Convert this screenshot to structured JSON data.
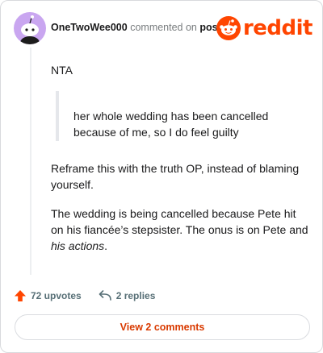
{
  "header": {
    "username": "OneTwoWee000",
    "action_text": "commented on",
    "post_link": "post",
    "logo_text": "reddit"
  },
  "comment": {
    "p1": "NTA",
    "quote": "her whole wedding has been cancelled because of me, so I do feel guilty",
    "p2": "Reframe this with the truth OP, instead of blaming yourself.",
    "p3_before": "The wedding is being cancelled because Pete hit on his fiancée’s stepsister. The onus is on Pete and ",
    "p3_em": "his actions",
    "p3_after": "."
  },
  "actions": {
    "upvotes": "72 upvotes",
    "replies": "2 replies"
  },
  "view_button": "View 2 comments",
  "colors": {
    "brand": "#ff4500",
    "upvote": "#ff4500",
    "button_text": "#d93a00",
    "avatar_bg": "#c9a6f0"
  },
  "icons": {
    "avatar": "snoo-avatar-icon",
    "logo": "reddit-snoo-icon",
    "upvote": "upvote-arrow-icon",
    "reply": "reply-arrow-icon"
  }
}
